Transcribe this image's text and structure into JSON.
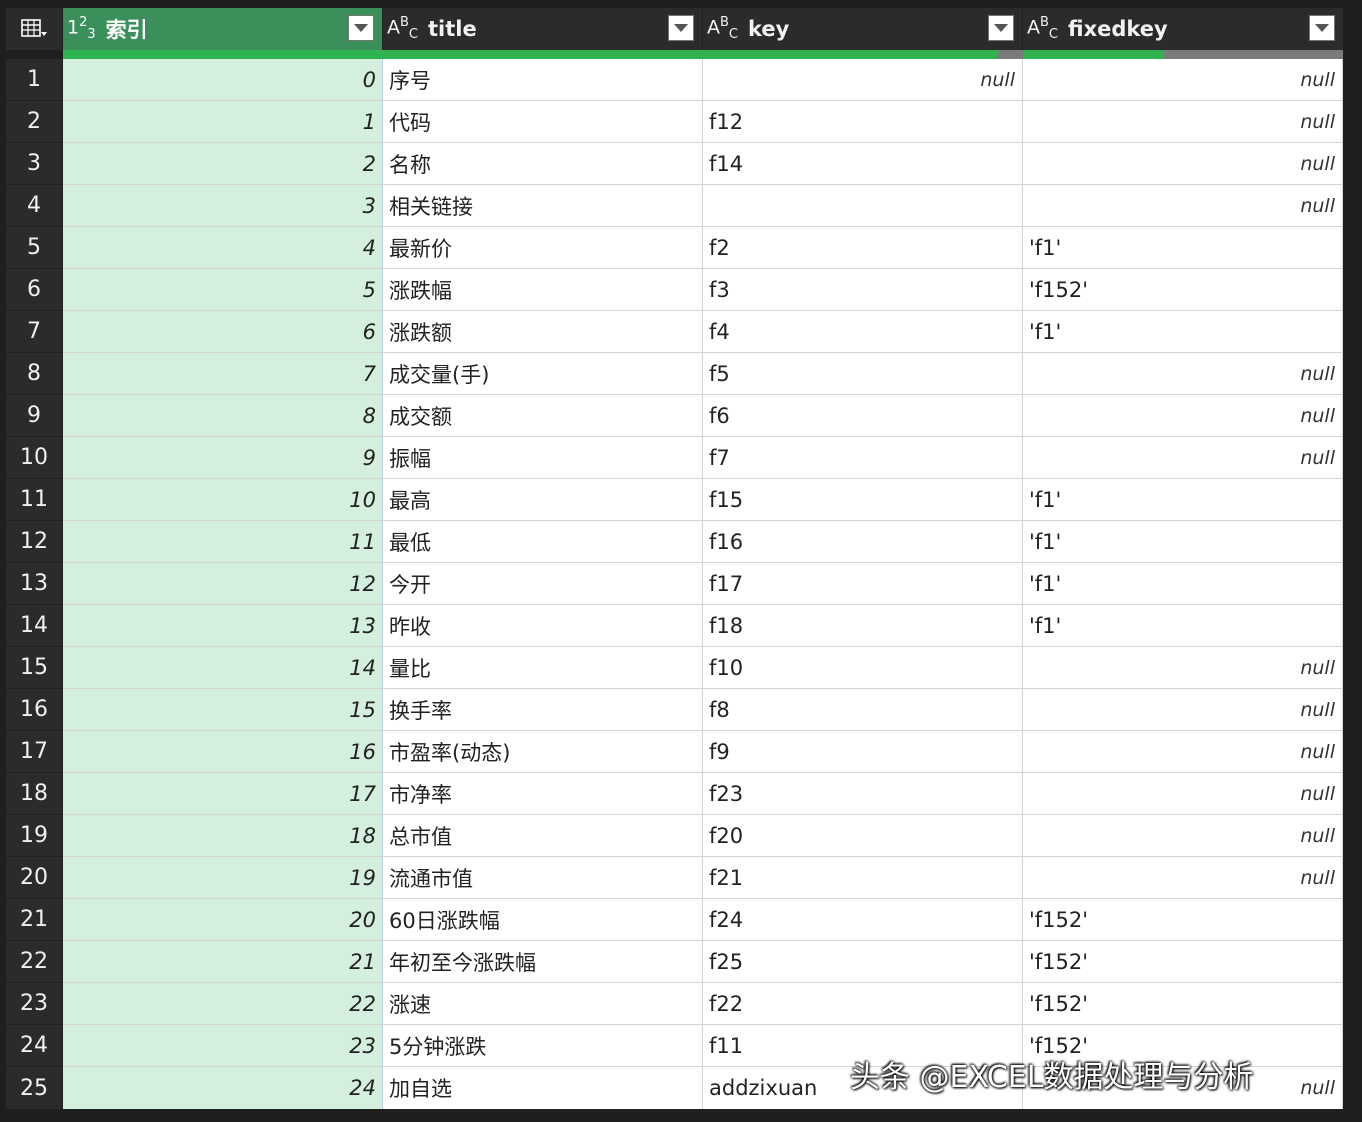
{
  "columns": [
    {
      "type_icon": "123",
      "label": "索引",
      "quality_valid": 1.0
    },
    {
      "type_icon": "ABC",
      "label": "title",
      "quality_valid": 1.0
    },
    {
      "type_icon": "ABC",
      "label": "key",
      "quality_valid": 0.92
    },
    {
      "type_icon": "ABC",
      "label": "fixedkey",
      "quality_valid": 0.44
    }
  ],
  "null_text": "null",
  "rows": [
    {
      "n": "1",
      "idx": "0",
      "title": "序号",
      "key": null,
      "fixedkey": null
    },
    {
      "n": "2",
      "idx": "1",
      "title": "代码",
      "key": "f12",
      "fixedkey": null
    },
    {
      "n": "3",
      "idx": "2",
      "title": "名称",
      "key": "f14",
      "fixedkey": null
    },
    {
      "n": "4",
      "idx": "3",
      "title": "相关链接",
      "key": "",
      "fixedkey": null
    },
    {
      "n": "5",
      "idx": "4",
      "title": "最新价",
      "key": "f2",
      "fixedkey": "'f1'"
    },
    {
      "n": "6",
      "idx": "5",
      "title": "涨跌幅",
      "key": "f3",
      "fixedkey": "'f152'"
    },
    {
      "n": "7",
      "idx": "6",
      "title": "涨跌额",
      "key": "f4",
      "fixedkey": "'f1'"
    },
    {
      "n": "8",
      "idx": "7",
      "title": "成交量(手)",
      "key": "f5",
      "fixedkey": null
    },
    {
      "n": "9",
      "idx": "8",
      "title": "成交额",
      "key": "f6",
      "fixedkey": null
    },
    {
      "n": "10",
      "idx": "9",
      "title": "振幅",
      "key": "f7",
      "fixedkey": null
    },
    {
      "n": "11",
      "idx": "10",
      "title": "最高",
      "key": "f15",
      "fixedkey": "'f1'"
    },
    {
      "n": "12",
      "idx": "11",
      "title": "最低",
      "key": "f16",
      "fixedkey": "'f1'"
    },
    {
      "n": "13",
      "idx": "12",
      "title": "今开",
      "key": "f17",
      "fixedkey": "'f1'"
    },
    {
      "n": "14",
      "idx": "13",
      "title": "昨收",
      "key": "f18",
      "fixedkey": "'f1'"
    },
    {
      "n": "15",
      "idx": "14",
      "title": "量比",
      "key": "f10",
      "fixedkey": null
    },
    {
      "n": "16",
      "idx": "15",
      "title": "换手率",
      "key": "f8",
      "fixedkey": null
    },
    {
      "n": "17",
      "idx": "16",
      "title": "市盈率(动态)",
      "key": "f9",
      "fixedkey": null
    },
    {
      "n": "18",
      "idx": "17",
      "title": "市净率",
      "key": "f23",
      "fixedkey": null
    },
    {
      "n": "19",
      "idx": "18",
      "title": "总市值",
      "key": "f20",
      "fixedkey": null
    },
    {
      "n": "20",
      "idx": "19",
      "title": "流通市值",
      "key": "f21",
      "fixedkey": null
    },
    {
      "n": "21",
      "idx": "20",
      "title": "60日涨跌幅",
      "key": "f24",
      "fixedkey": "'f152'"
    },
    {
      "n": "22",
      "idx": "21",
      "title": "年初至今涨跌幅",
      "key": "f25",
      "fixedkey": "'f152'"
    },
    {
      "n": "23",
      "idx": "22",
      "title": "涨速",
      "key": "f22",
      "fixedkey": "'f152'"
    },
    {
      "n": "24",
      "idx": "23",
      "title": "5分钟涨跌",
      "key": "f11",
      "fixedkey": "'f152'"
    },
    {
      "n": "25",
      "idx": "24",
      "title": "加自选",
      "key": "addzixuan",
      "fixedkey": null
    }
  ],
  "watermark": "头条 @EXCEL数据处理与分析"
}
